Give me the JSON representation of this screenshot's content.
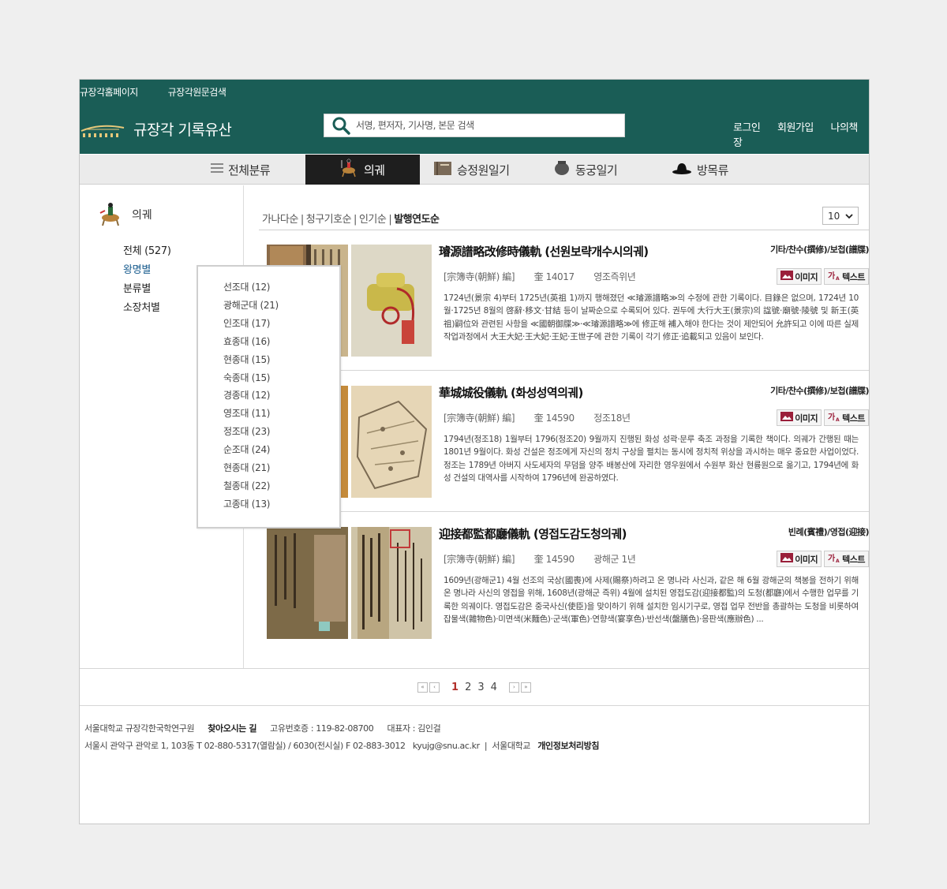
{
  "header": {
    "toplinks": [
      "규장각홈페이지",
      "규장각원문검색"
    ],
    "logo_text": "규장각 기록유산",
    "search_placeholder": "서명, 편저자, 기사명, 본문 검색",
    "user_links": [
      "로그인",
      "회원가입",
      "나의책장"
    ]
  },
  "nav": {
    "items": [
      "전체분류",
      "의궤",
      "승정원일기",
      "동궁일기",
      "방목류"
    ],
    "active": "의궤"
  },
  "sidebar": {
    "title": "의궤",
    "menu": [
      "전체 (527)",
      "왕명별",
      "분류별",
      "소장처별"
    ],
    "active_menu": "왕명별"
  },
  "dropdown": {
    "items": [
      "선조대 (12)",
      "광해군대 (21)",
      "인조대 (17)",
      "효종대 (16)",
      "현종대 (15)",
      "숙종대 (15)",
      "경종대 (12)",
      "영조대 (11)",
      "정조대 (23)",
      "순조대 (24)",
      "현종대 (21)",
      "철종대 (22)",
      "고종대 (13)"
    ]
  },
  "sort": {
    "options": [
      "가나다순",
      "청구기호순",
      "인기순",
      "발행연도순"
    ],
    "current": "발행연도순",
    "page_size": "10"
  },
  "results": [
    {
      "title": "璿源譜略改修時儀軌 (선원보략개수시의궤)",
      "category": "기타/찬수(撰修)/보첩(譜牒)",
      "author": "[宗簿寺(朝鮮) 編]",
      "call_no": "奎 14017",
      "date": "영조즉위년",
      "image_btn": "이미지",
      "text_btn": "텍스트",
      "desc": "1724년(景宗 4)부터 1725년(英祖 1)까지 행해졌던 ≪璿源譜略≫의 수정에 관한 기록이다. 目錄은 없으며, 1724년 10월·1725년 8월의 啓辭·移文·甘結 등이 날짜순으로 수록되어 있다. 권두에 大行大王(景宗)의 諡號·廟號·陵號 및 新王(英祖)嗣位와 관련된 사항을 ≪國朝御牒≫·≪璿源譜略≫에 修正해 補入해야 한다는 것이 제안되어 允許되고 이에 따른 실제 작업과정에서 大王大妃·王大妃·王妃·王世子에 관한 기록이 각기 修正·追載되고 있음이 보인다."
    },
    {
      "title": "華城城役儀軌 (화성성역의궤)",
      "category": "기타/찬수(撰修)/보첩(譜牒)",
      "author": "[宗簿寺(朝鮮) 編]",
      "call_no": "奎 14590",
      "date": "정조18년",
      "image_btn": "이미지",
      "text_btn": "텍스트",
      "desc": "1794년(정조18) 1월부터 1796(정조20) 9월까지 진행된 화성 성곽·문루 축조 과정을 기록한 책이다. 의궤가 간행된 때는 1801년 9월이다. 화성 건설은 정조에게 자신의 정치 구상을 펼치는 동시에 정치적 위상을 과시하는 매우 중요한 사업이었다. 정조는 1789년 아버지 사도세자의 무덤을 양주 배봉산에 자리한 영우원에서 수원부 화산 현륭원으로 옮기고, 1794년에 화성 건설의 대역사를 시작하여 1796년에 완공하였다."
    },
    {
      "title": "迎接都監都廳儀軌 (영접도감도청의궤)",
      "category": "빈례(賓禮)/영접(迎接)",
      "author": "[宗簿寺(朝鮮) 編]",
      "call_no": "奎 14590",
      "date": "광해군 1년",
      "image_btn": "이미지",
      "text_btn": "텍스트",
      "desc": "1609년(광해군1) 4월 선조의 국상(國喪)에 사제(賜祭)하려고 온 명나라 사신과, 같은 해 6월 광해군의 책봉을 전하기 위해 온 명나라 사신의 영접을 위해, 1608년(광해군 즉위) 4월에 설치된 영접도감(迎接都監)의 도청(都廳)에서 수행한 업무를 기록한 의궤이다. 영접도감은 중국사신(使臣)을 맞이하기 위해 설치한 임시기구로, 영접 업무 전반을 총괄하는 도청을 비롯하여 잡물색(雜物色)·미면색(米麵色)·군색(軍色)·연향색(宴享色)·반선색(盤膳色)·응판색(應辦色) ..."
    }
  ],
  "pagination": {
    "pages": [
      "1",
      "2",
      "3",
      "4"
    ],
    "current": "1"
  },
  "footer": {
    "org": "서울대학교 규장각한국학연구원",
    "directions": "찾아오시는 길",
    "biz_no": "고유번호증 : 119-82-08700",
    "rep": "대표자 : 김인걸",
    "address": "서울시 관악구 관악로 1, 103동  T 02-880-5317(열람실) / 6030(전시실) F 02-883-3012",
    "email": "kyujg@snu.ac.kr",
    "univ": "서울대학교",
    "privacy": "개인정보처리방침"
  },
  "colors": {
    "header_bg": "#1a5d56",
    "nav_active_bg": "#1e1e1e",
    "page_current": "#b2302b"
  }
}
